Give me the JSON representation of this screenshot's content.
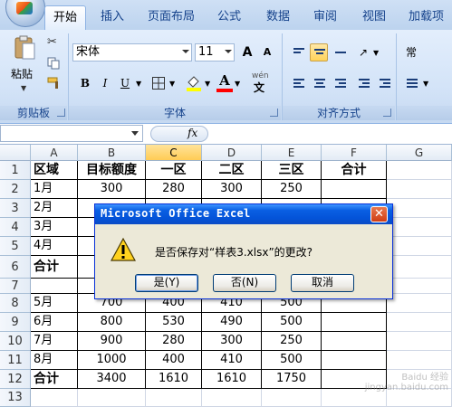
{
  "ribbon": {
    "tabs": [
      "开始",
      "插入",
      "页面布局",
      "公式",
      "数据",
      "审阅",
      "视图",
      "加载项"
    ],
    "active_tab": "开始",
    "clipboard": {
      "paste_label": "粘贴",
      "group_label": "剪贴板"
    },
    "font": {
      "font_name": "宋体",
      "font_size": "11",
      "size_up": "A",
      "size_down": "A",
      "bold": "B",
      "italic": "I",
      "underline": "U",
      "font_color_letter": "A",
      "wen_label": "wén",
      "wen_char": "文",
      "group_label": "字体"
    },
    "alignment": {
      "group_label": "对齐方式"
    },
    "extra_glyph": "常"
  },
  "formula_bar": {
    "fx_label": "fx",
    "name_box_value": "",
    "formula_value": ""
  },
  "sheet": {
    "columns": [
      "A",
      "B",
      "C",
      "D",
      "E",
      "F",
      "G"
    ],
    "selected_column": "C",
    "rows": [
      {
        "num": "1",
        "cells": [
          "区域",
          "目标额度",
          "一区",
          "二区",
          "三区",
          "合计"
        ]
      },
      {
        "num": "2",
        "cells": [
          "1月",
          "300",
          "280",
          "300",
          "250",
          ""
        ]
      },
      {
        "num": "3",
        "cells": [
          "2月",
          "",
          "",
          "",
          "",
          ""
        ]
      },
      {
        "num": "4",
        "cells": [
          "3月",
          "",
          "",
          "",
          "",
          ""
        ]
      },
      {
        "num": "5",
        "cells": [
          "4月",
          "",
          "",
          "",
          "",
          ""
        ]
      },
      {
        "num": "6",
        "cells": [
          "合计",
          "",
          "",
          "",
          "",
          ""
        ]
      },
      {
        "num": "7",
        "cells": [
          "",
          "",
          "",
          "",
          "",
          ""
        ]
      },
      {
        "num": "8",
        "cells": [
          "5月",
          "700",
          "400",
          "410",
          "500",
          ""
        ]
      },
      {
        "num": "9",
        "cells": [
          "6月",
          "800",
          "530",
          "490",
          "500",
          ""
        ]
      },
      {
        "num": "10",
        "cells": [
          "7月",
          "900",
          "280",
          "300",
          "250",
          ""
        ]
      },
      {
        "num": "11",
        "cells": [
          "8月",
          "1000",
          "400",
          "410",
          "500",
          ""
        ]
      },
      {
        "num": "12",
        "cells": [
          "合计",
          "3400",
          "1610",
          "1610",
          "1750",
          ""
        ]
      },
      {
        "num": "13",
        "cells": [
          "",
          "",
          "",
          "",
          "",
          ""
        ]
      }
    ]
  },
  "dialog": {
    "title": "Microsoft Office Excel",
    "close_glyph": "✕",
    "message": "是否保存对“样表3.xlsx”的更改?",
    "buttons": {
      "yes": "是(Y)",
      "no": "否(N)",
      "cancel": "取消"
    }
  },
  "watermark": "Baidu 经验 jingyan.baidu.com"
}
